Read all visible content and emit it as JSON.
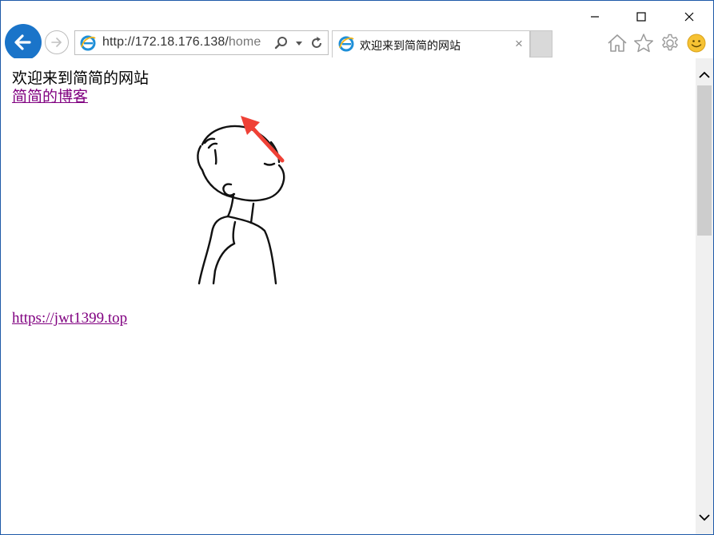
{
  "window": {
    "controls": {
      "minimize": "minimize-icon",
      "maximize": "maximize-icon",
      "close": "close-icon"
    }
  },
  "nav": {
    "back_icon": "back-arrow-icon",
    "forward_icon": "forward-arrow-icon"
  },
  "address_bar": {
    "url_host": "http://172.18.176.138/",
    "url_path": "home",
    "search_icon": "search-icon",
    "dropdown_icon": "chevron-down-icon",
    "refresh_icon": "refresh-icon"
  },
  "tab": {
    "title": "欢迎来到简简的网站",
    "close_label": "×"
  },
  "toolbar": {
    "icons": [
      "home-icon",
      "favorites-star-icon",
      "settings-gear-icon",
      "feedback-smiley-icon"
    ]
  },
  "page": {
    "welcome_text": "欢迎来到简简的网站",
    "blog_link": "简简的博客",
    "site_link": "https://jwt1399.top"
  },
  "colors": {
    "accent": "#1a74c9",
    "visited_link": "#800080",
    "annotation_arrow": "#ef4136",
    "window_border": "#1e5aa8"
  }
}
